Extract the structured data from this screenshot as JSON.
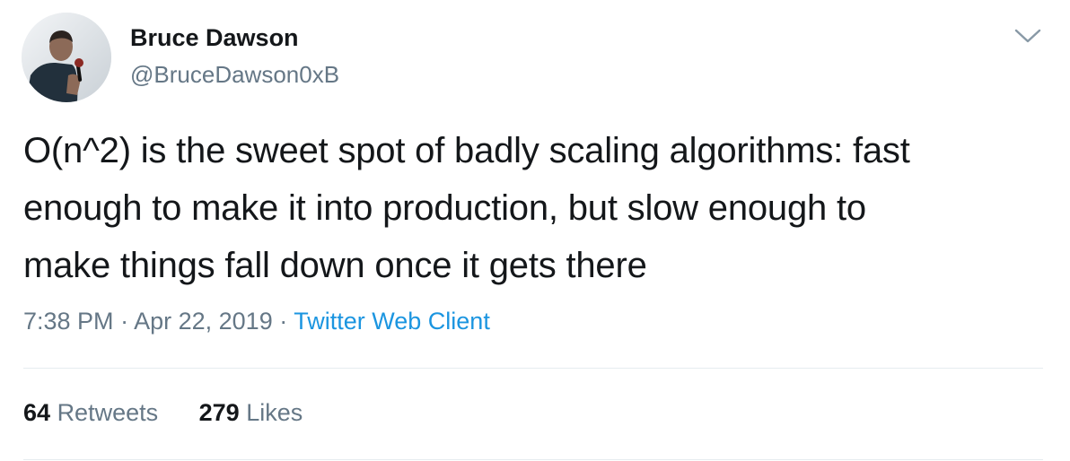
{
  "author": {
    "name": "Bruce Dawson",
    "handle": "@BruceDawson0xB",
    "avatar_icon": "profile-photo"
  },
  "tweet": {
    "lines": [
      "O(n^2) is the sweet spot of badly scaling algorithms: fast",
      "enough to make it into production, but slow enough to",
      "make things fall down once it gets there"
    ],
    "time": "7:38 PM",
    "separator": "·",
    "date": "Apr 22, 2019",
    "source": "Twitter Web Client"
  },
  "stats": {
    "retweets_count": "64",
    "retweets_label": "Retweets",
    "likes_count": "279",
    "likes_label": "Likes"
  },
  "icons": {
    "menu": "chevron-down-icon"
  },
  "colors": {
    "text": "#14171a",
    "secondary": "#657786",
    "link": "#1b95e0",
    "divider": "#e6ecf0"
  }
}
